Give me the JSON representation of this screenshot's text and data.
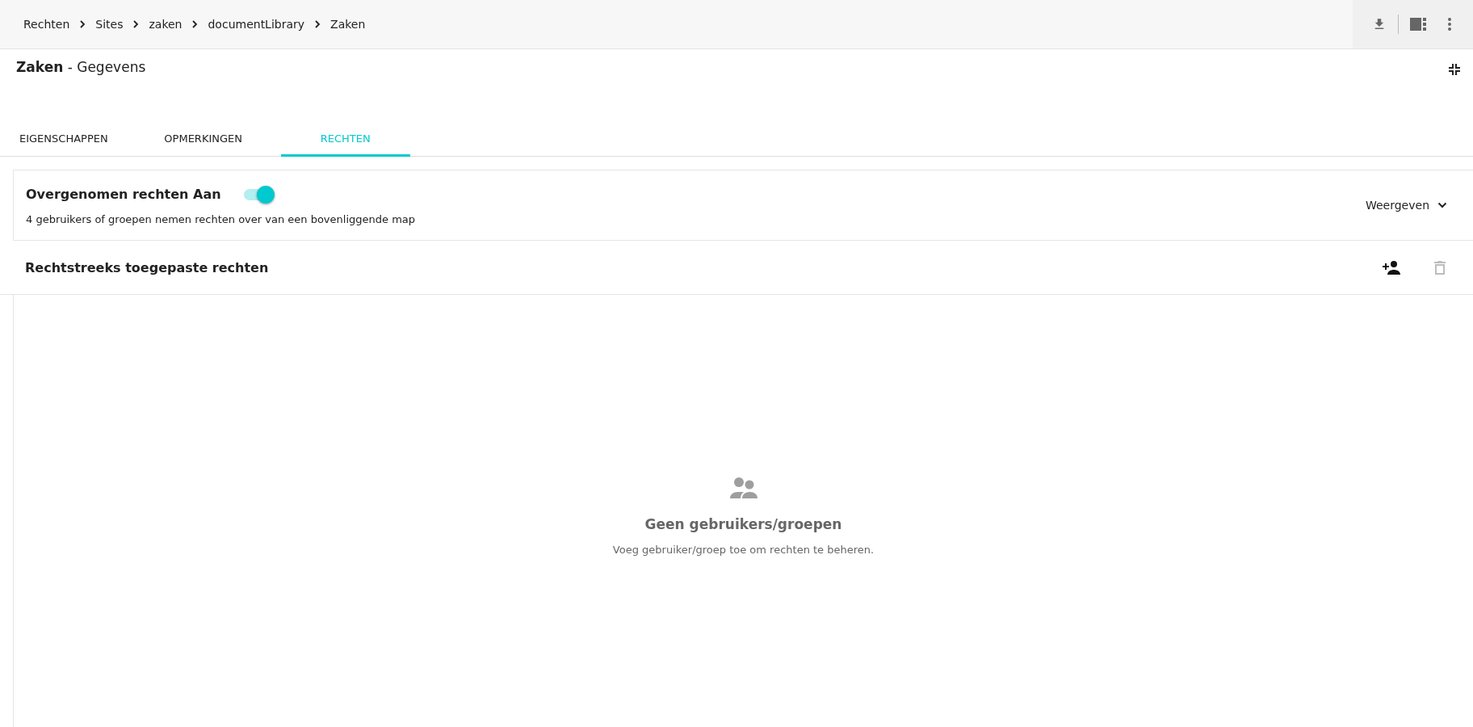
{
  "breadcrumb": [
    {
      "label": "Rechten"
    },
    {
      "label": "Sites"
    },
    {
      "label": "zaken"
    },
    {
      "label": "documentLibrary"
    },
    {
      "label": "Zaken"
    }
  ],
  "title": "**Zaken** - Gegevens",
  "tabs": [
    {
      "label": "EIGENSCHAPPEN",
      "selected": false
    },
    {
      "label": "OPMERKINGEN",
      "selected": false
    },
    {
      "label": "RECHTEN",
      "selected": true
    }
  ],
  "inherited": {
    "title": "Overgenomen rechten Aan",
    "toggle_on": true,
    "description": "4 gebruikers of groepen nemen rechten over van een bovenliggende map",
    "expand_label": "Weergeven"
  },
  "direct": {
    "title": "Rechtstreeks toegepaste rechten",
    "delete_disabled": true,
    "empty_title": "Geen gebruikers/groepen",
    "empty_message": "Voeg gebruiker/groep toe om rechten te beheren."
  }
}
